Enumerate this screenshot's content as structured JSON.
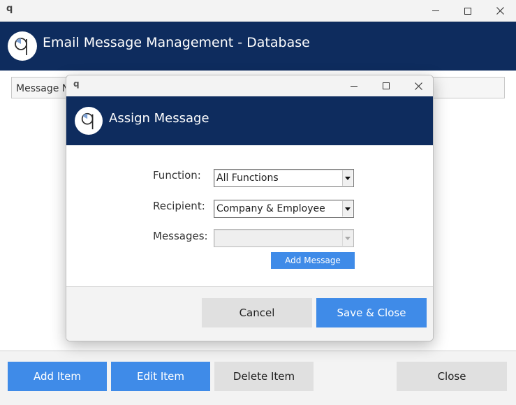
{
  "outer_window": {
    "app_glyph": "q",
    "title": "Email Message Management - Database",
    "search_text": "Message Na",
    "footer_buttons": {
      "add": "Add Item",
      "edit": "Edit Item",
      "delete": "Delete Item",
      "close": "Close"
    }
  },
  "dialog": {
    "app_glyph": "q",
    "title": "Assign Message",
    "fields": {
      "function_label": "Function:",
      "function_value": "All Functions",
      "recipient_label": "Recipient:",
      "recipient_value": "Company & Employee",
      "messages_label": "Messages:",
      "messages_value": ""
    },
    "add_message_label": "Add Message",
    "cancel_label": "Cancel",
    "save_label": "Save & Close"
  },
  "colors": {
    "header_navy": "#0e2c5e",
    "primary_blue": "#3f8be8",
    "secondary_gray": "#e0e0e0"
  }
}
